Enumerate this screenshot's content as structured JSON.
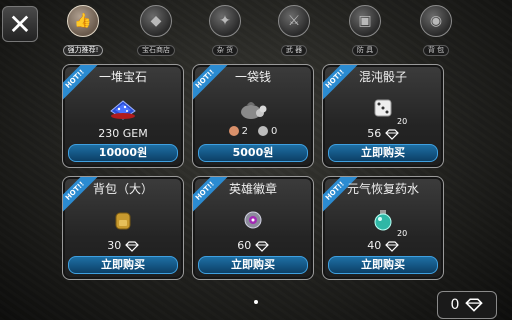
{
  "tabs": [
    {
      "label": "强力推荐!",
      "icon": "thumbs-up-icon",
      "active": true
    },
    {
      "label": "宝石商店",
      "icon": "gem-icon",
      "active": false
    },
    {
      "label": "杂 货",
      "icon": "compass-icon",
      "active": false
    },
    {
      "label": "武 器",
      "icon": "sword-icon",
      "active": false
    },
    {
      "label": "防 具",
      "icon": "armor-icon",
      "active": false
    },
    {
      "label": "背 包",
      "icon": "bag-icon",
      "active": false
    }
  ],
  "hot_label": "HOT!!",
  "items": [
    {
      "name": "一堆宝石",
      "amount": "230 GEM",
      "price": "10000원",
      "icon": "gem-pile-icon"
    },
    {
      "name": "一袋钱",
      "coin_a": "2",
      "coin_b": "0",
      "price": "5000원",
      "icon": "money-bag-icon"
    },
    {
      "name": "混沌骰子",
      "count": "20",
      "gem_price": "56",
      "button": "立即购买",
      "icon": "dice-icon"
    },
    {
      "name": "背包（大）",
      "gem_price": "30",
      "button": "立即购买",
      "icon": "backpack-icon"
    },
    {
      "name": "英雄徽章",
      "gem_price": "60",
      "button": "立即购买",
      "icon": "badge-icon"
    },
    {
      "name": "元气恢复药水",
      "count": "20",
      "gem_price": "40",
      "button": "立即购买",
      "icon": "potion-icon"
    }
  ],
  "balance": "0",
  "colors": {
    "accent": "#2b8bd1",
    "button": "#1e6fa5",
    "gem": "#ffffff"
  }
}
